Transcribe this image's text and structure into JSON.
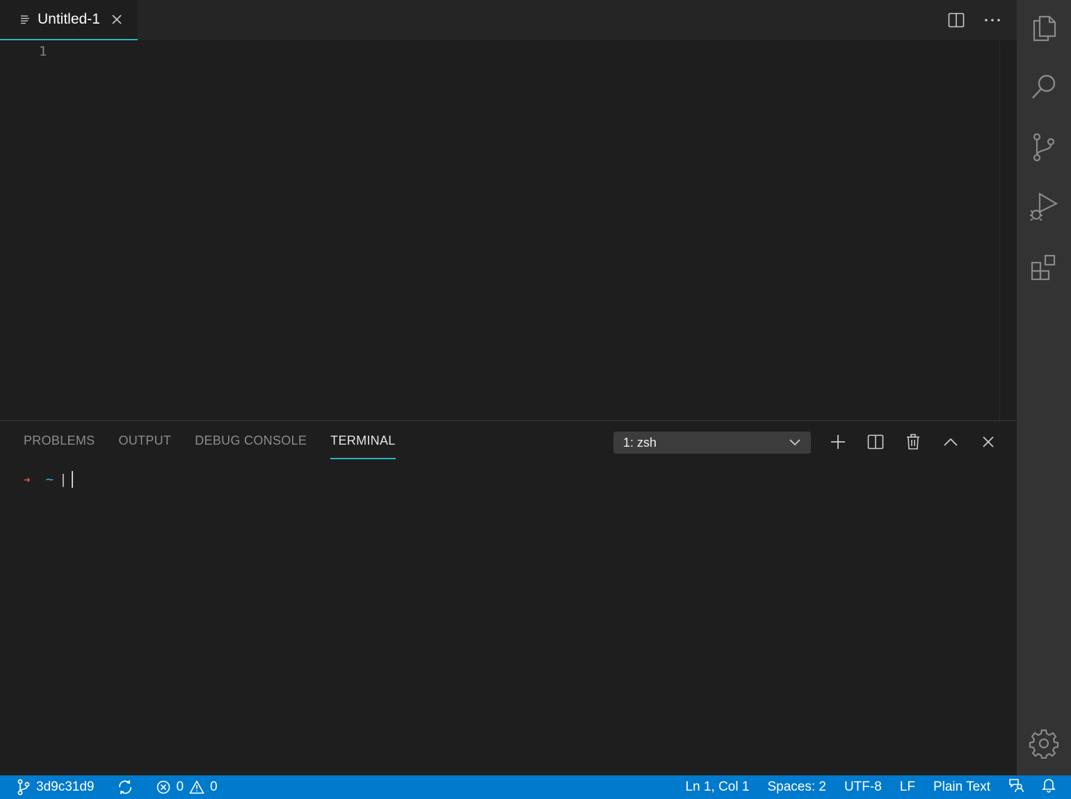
{
  "editor": {
    "tab": {
      "title": "Untitled-1"
    },
    "line_numbers": [
      "1"
    ]
  },
  "panel": {
    "tabs": [
      {
        "label": "PROBLEMS",
        "active": false
      },
      {
        "label": "OUTPUT",
        "active": false
      },
      {
        "label": "DEBUG CONSOLE",
        "active": false
      },
      {
        "label": "TERMINAL",
        "active": true
      }
    ],
    "terminal_select": {
      "value": "1: zsh"
    },
    "terminal": {
      "prompt_arrow": "➜",
      "directory": "~",
      "input": "|"
    }
  },
  "status_bar": {
    "branch": "3d9c31d9",
    "errors": "0",
    "warnings": "0",
    "cursor_position": "Ln 1, Col 1",
    "indentation": "Spaces: 2",
    "encoding": "UTF-8",
    "line_ending": "LF",
    "language": "Plain Text"
  },
  "colors": {
    "accent": "#2cb5c4",
    "status_bar_bg": "#007acc",
    "editor_bg": "#1e1e1e",
    "activity_bar_bg": "#333333",
    "prompt_arrow": "#f14c4c",
    "prompt_dir": "#29b8db"
  },
  "icons": {
    "activity_bar": [
      "explorer-icon",
      "search-icon",
      "source-control-icon",
      "run-debug-icon",
      "extensions-icon",
      "settings-gear-icon"
    ]
  }
}
